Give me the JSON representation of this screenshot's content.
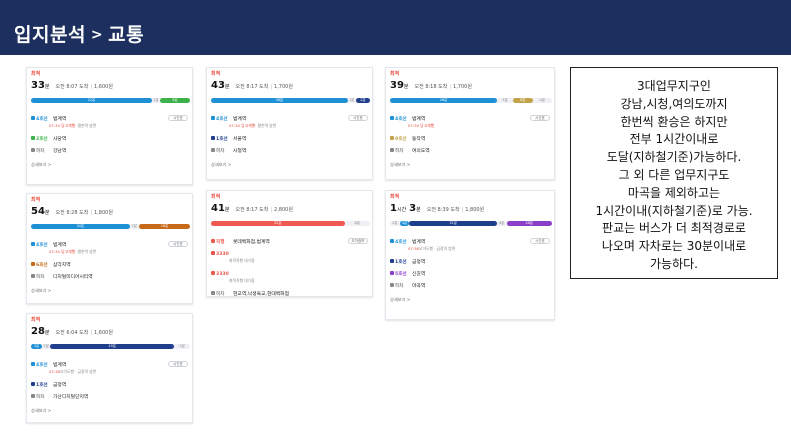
{
  "header": {
    "title": "입지분석",
    "separator": ">",
    "subtitle": "교통"
  },
  "colors": {
    "header_bg": "#1d2f5e",
    "line4": "#1e90d6",
    "line2": "#3db24a",
    "line1": "#1f3f8c",
    "line6": "#c66a1a",
    "line9": "#c3a34a",
    "line5": "#8a3fc9",
    "bus_red": "#ef5a50",
    "walk": "#cfd3da"
  },
  "cards": [
    {
      "badge": "최적",
      "time_main": "33",
      "time_unit": "분",
      "arrival": "오전 8:07 도착",
      "fare": "1,600원",
      "segments": [
        {
          "label": "22분",
          "frac": 0.76,
          "color": "#1e90d6"
        },
        {
          "label": "1분",
          "frac": 0.05,
          "color": "#eef0f4"
        },
        {
          "label": "5분",
          "frac": 0.19,
          "color": "#3db24a"
        }
      ],
      "steps": [
        {
          "line": "4호선",
          "station": "범계역",
          "note_red": "07:34 당고개행",
          "note_grey": "· 평촌역 방면",
          "chip": "시간표",
          "color": "#1e90d6"
        },
        {
          "line": "2호선",
          "station": "사당역",
          "color": "#3db24a"
        },
        {
          "line": "하차",
          "station": "강남역",
          "color": "#888888"
        }
      ],
      "detail": "상세보기 >"
    },
    {
      "badge": "최적",
      "time_main": "43",
      "time_unit": "분",
      "arrival": "오전 8:17 도착",
      "fare": "1,700원",
      "segments": [
        {
          "label": "38분",
          "frac": 0.86,
          "color": "#1e90d6"
        },
        {
          "label": "1분",
          "frac": 0.05,
          "color": "#eef0f4"
        },
        {
          "label": "2분",
          "frac": 0.09,
          "color": "#1f3f8c"
        }
      ],
      "steps": [
        {
          "line": "4호선",
          "station": "범계역",
          "note_red": "07:34 당고개행",
          "note_grey": "· 평촌역 방면",
          "chip": "시간표",
          "color": "#1e90d6"
        },
        {
          "line": "1호선",
          "station": "서울역",
          "color": "#1f3f8c"
        },
        {
          "line": "하차",
          "station": "시청역",
          "color": "#888888"
        }
      ],
      "detail": "상세보기 >"
    },
    {
      "badge": "최적",
      "time_main": "39",
      "time_unit": "분",
      "arrival": "오전 8:18 도착",
      "fare": "1,700원",
      "segments": [
        {
          "label": "26분",
          "frac": 0.66,
          "color": "#1e90d6"
        },
        {
          "label": "3분",
          "frac": 0.1,
          "color": "#eef0f4"
        },
        {
          "label": "6분",
          "frac": 0.12,
          "color": "#c3a34a"
        },
        {
          "label": "4분",
          "frac": 0.12,
          "color": "#eef0f4"
        }
      ],
      "steps": [
        {
          "line": "4호선",
          "station": "범계역",
          "note_red": "07:39 당고개행",
          "note_grey": "",
          "chip": "시간표",
          "color": "#1e90d6"
        },
        {
          "line": "9호선",
          "station": "동작역",
          "color": "#c3a34a"
        },
        {
          "line": "하차",
          "station": "여의도역",
          "color": "#888888"
        }
      ],
      "detail": "상세보기 >"
    },
    {
      "badge": "최적",
      "time_main": "54",
      "time_unit": "분",
      "arrival": "오전 8:28 도착",
      "fare": "1,800원",
      "segments": [
        {
          "label": "34분",
          "frac": 0.62,
          "color": "#1e90d6"
        },
        {
          "label": "2분",
          "frac": 0.06,
          "color": "#eef0f4"
        },
        {
          "label": "18분",
          "frac": 0.32,
          "color": "#c66a1a"
        }
      ],
      "steps": [
        {
          "line": "4호선",
          "station": "범계역",
          "note_red": "07:34 당고개행",
          "note_grey": "· 평촌역 방면",
          "chip": "시간표",
          "color": "#1e90d6"
        },
        {
          "line": "6호선",
          "station": "삼각지역",
          "color": "#c66a1a"
        },
        {
          "line": "하차",
          "station": "디지털미디어시티역",
          "color": "#888888"
        }
      ],
      "detail": "상세보기 >"
    },
    {
      "badge": "최적",
      "time_main": "41",
      "time_unit": "분",
      "arrival": "오전 8:17 도착",
      "fare": "2,800원",
      "segments": [
        {
          "label": "32분",
          "frac": 0.84,
          "color": "#ef5a50"
        },
        {
          "label": "8분",
          "frac": 0.16,
          "color": "#eef0f4"
        }
      ],
      "steps": [
        {
          "line": "직행",
          "station": "롯데백화점,범계역",
          "chip": "도착정보",
          "color": "#ef5a50"
        },
        {
          "line": "3330",
          "station": "",
          "note_red": "",
          "note_grey": "최적직행 대기중",
          "color": "#ef5a50"
        },
        {
          "line": "3330",
          "station": "",
          "note_red": "",
          "note_grey": "최적직행 대기중",
          "color": "#ef5a50"
        },
        {
          "line": "하차",
          "station": "현교역,낙생육교,현대백화점",
          "color": "#888888"
        }
      ],
      "detail": "상세보기 >"
    },
    {
      "badge": "최적",
      "time_prefix": "1",
      "time_prefix_unit": "시간",
      "time_main": "3",
      "time_unit": "분",
      "arrival": "오전 8:39 도착",
      "fare": "1,800원",
      "segments": [
        {
          "label": "2분",
          "frac": 0.06,
          "color": "#eef0f4"
        },
        {
          "label": "4분",
          "frac": 0.06,
          "color": "#1e90d6"
        },
        {
          "label": "31분",
          "frac": 0.54,
          "color": "#1f3f8c"
        },
        {
          "label": "4분",
          "frac": 0.06,
          "color": "#eef0f4"
        },
        {
          "label": "28분",
          "frac": 0.28,
          "color": "#8a3fc9"
        }
      ],
      "steps": [
        {
          "line": "4호선",
          "station": "범계역",
          "note_red": "07:36",
          "note_grey": "오이도행 · 금정역 방면",
          "chip": "시간표",
          "color": "#1e90d6"
        },
        {
          "line": "1호선",
          "station": "금정역",
          "color": "#1f3f8c"
        },
        {
          "line": "5호선",
          "station": "신길역",
          "color": "#8a3fc9"
        },
        {
          "line": "하차",
          "station": "마곡역",
          "color": "#888888"
        }
      ],
      "detail": "상세보기 >"
    },
    {
      "badge": "최적",
      "time_main": "28",
      "time_unit": "분",
      "arrival": "오전 6:04 도착",
      "fare": "1,600원",
      "segments": [
        {
          "label": "2분",
          "frac": 0.07,
          "color": "#1e90d6"
        },
        {
          "label": "2분",
          "frac": 0.05,
          "color": "#eef0f4"
        },
        {
          "label": "19분",
          "frac": 0.78,
          "color": "#1f3f8c"
        },
        {
          "label": "3분",
          "frac": 0.1,
          "color": "#eef0f4"
        }
      ],
      "steps": [
        {
          "line": "4호선",
          "station": "범계역",
          "note_red": "07:36",
          "note_grey": "오이도행 · 금정역 방면",
          "chip": "시간표",
          "color": "#1e90d6"
        },
        {
          "line": "1호선",
          "station": "금정역",
          "color": "#1f3f8c"
        },
        {
          "line": "하차",
          "station": "가산디지털단지역",
          "color": "#888888"
        }
      ],
      "detail": "상세보기 >"
    }
  ],
  "summary_text": [
    "3대업무지구인",
    "강남,시청,여의도까지",
    "한번씩 환승은 하지만",
    "전부 1시간이내로",
    "도달(지하철기준)가능하다.",
    "그 외 다른 업무지구도",
    "마곡을 제외하고는",
    "1시간이내(지하철기준)로 가능.",
    "판교는 버스가 더 최적경로로",
    "나오며 자차로는 30분이내로",
    "가능하다."
  ]
}
